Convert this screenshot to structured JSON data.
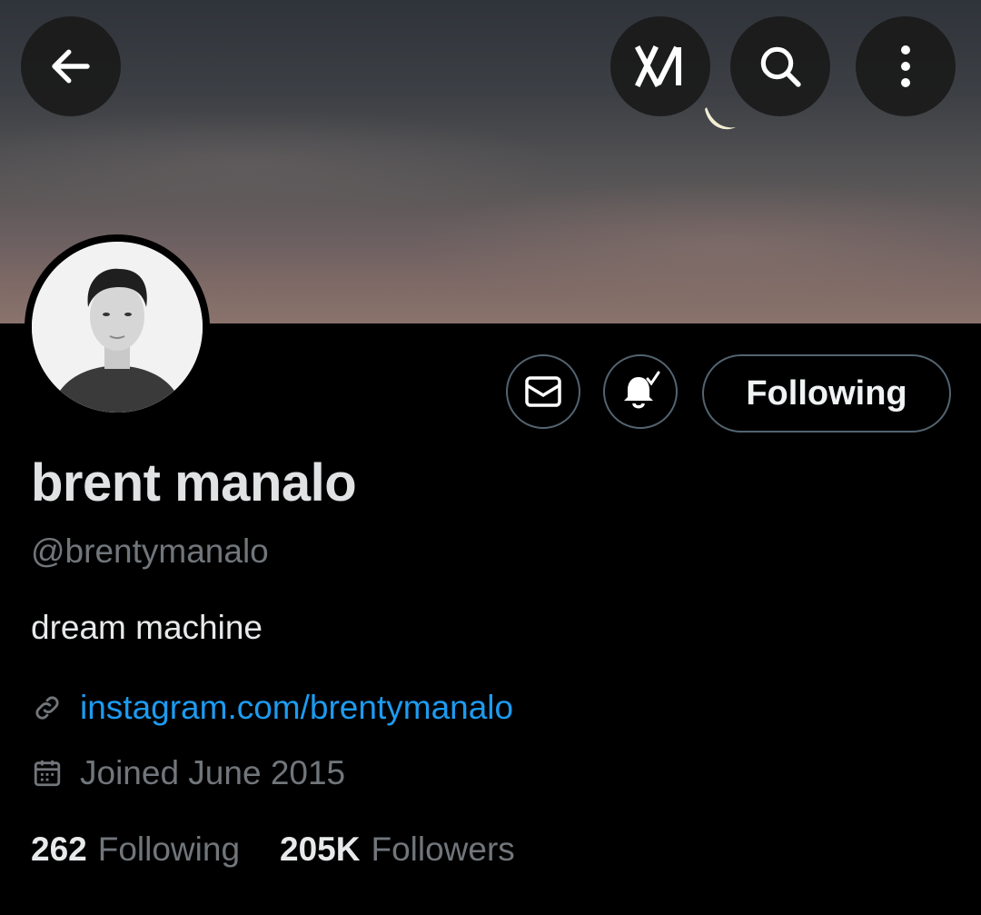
{
  "header": {
    "back_icon": "arrow-left-icon",
    "grok_icon": "grok-icon",
    "search_icon": "search-icon",
    "more_icon": "more-vertical-icon"
  },
  "profile": {
    "name": "brent manalo",
    "handle": "@brentymanalo",
    "bio": "dream machine",
    "link": "instagram.com/brentymanalo",
    "joined": "Joined June 2015"
  },
  "actions": {
    "message_icon": "envelope-icon",
    "notify_icon": "bell-check-icon",
    "follow_label": "Following"
  },
  "stats": {
    "following_count": "262",
    "following_label": "Following",
    "followers_count": "205K",
    "followers_label": "Followers"
  },
  "colors": {
    "accent": "#1d9bf0",
    "muted": "#71767b",
    "border": "#536471"
  }
}
